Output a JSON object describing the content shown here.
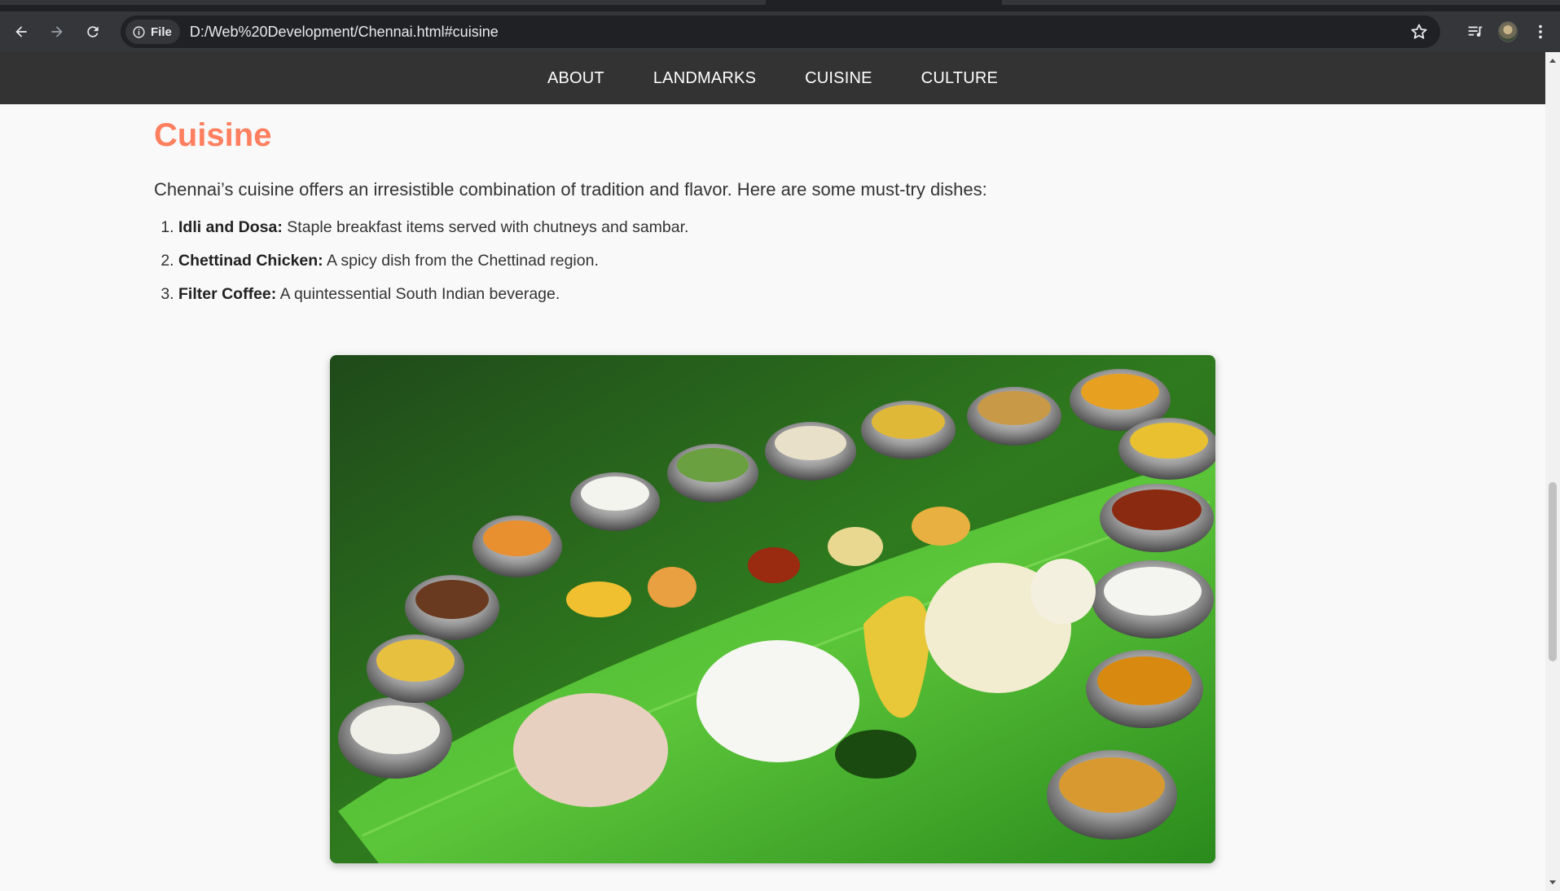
{
  "browser": {
    "site_chip_label": "File",
    "url": "D:/Web%20Development/Chennai.html#cuisine",
    "icons": [
      "back-icon",
      "forward-icon",
      "reload-icon",
      "info-icon",
      "star-icon",
      "media-icon",
      "avatar",
      "menu-icon"
    ]
  },
  "nav": {
    "items": [
      {
        "label": "ABOUT"
      },
      {
        "label": "LANDMARKS"
      },
      {
        "label": "CUISINE"
      },
      {
        "label": "CULTURE"
      }
    ]
  },
  "cuisine": {
    "title": "Cuisine",
    "intro": "Chennai’s cuisine offers an irresistible combination of tradition and flavor. Here are some must-try dishes:",
    "dishes": [
      {
        "name": "Idli and Dosa:",
        "desc": " Staple breakfast items served with chutneys and sambar."
      },
      {
        "name": "Chettinad Chicken:",
        "desc": " A spicy dish from the Chettinad region."
      },
      {
        "name": "Filter Coffee:",
        "desc": " A quintessential South Indian beverage."
      }
    ]
  },
  "colors": {
    "title_accent": "#ff7f5f",
    "nav_bg": "#333333",
    "page_bg": "#f9f9f9"
  }
}
